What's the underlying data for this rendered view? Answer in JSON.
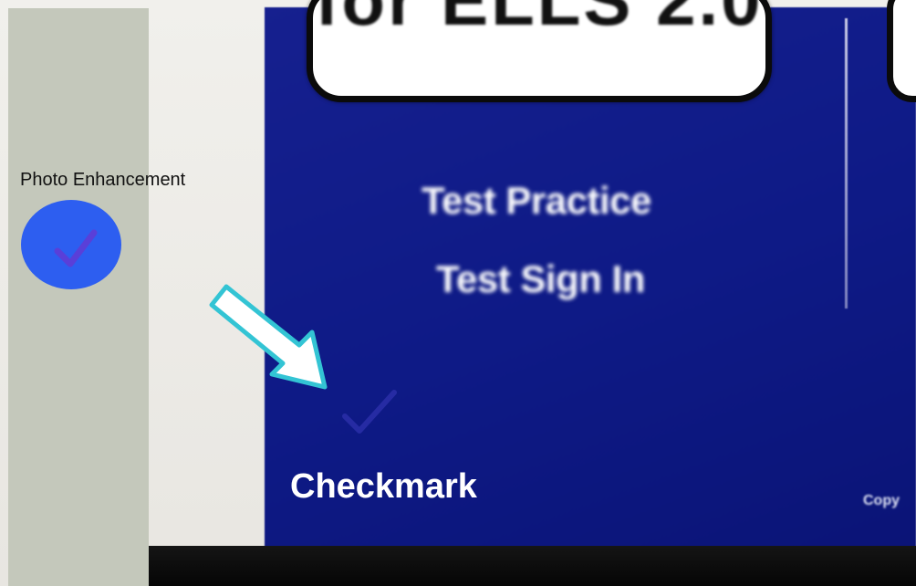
{
  "screen": {
    "title_partial": "for ELLS 2.0",
    "menu_items": [
      "Test Practice",
      "Test Sign In"
    ],
    "copyright_partial": "Copy"
  },
  "annotations": {
    "photo_enhancement_label": "Photo Enhancement",
    "checkmark_label": "Checkmark",
    "checkmark_icon": "checkmark-icon",
    "arrow_icon": "arrow-icon"
  },
  "colors": {
    "screen_blue": "#0e1a86",
    "sidebar": "#c4c8bb",
    "check_circle": "#2d5ef0",
    "check_stroke": "#5a3fd8",
    "arrow_outline": "#33c4d4"
  }
}
